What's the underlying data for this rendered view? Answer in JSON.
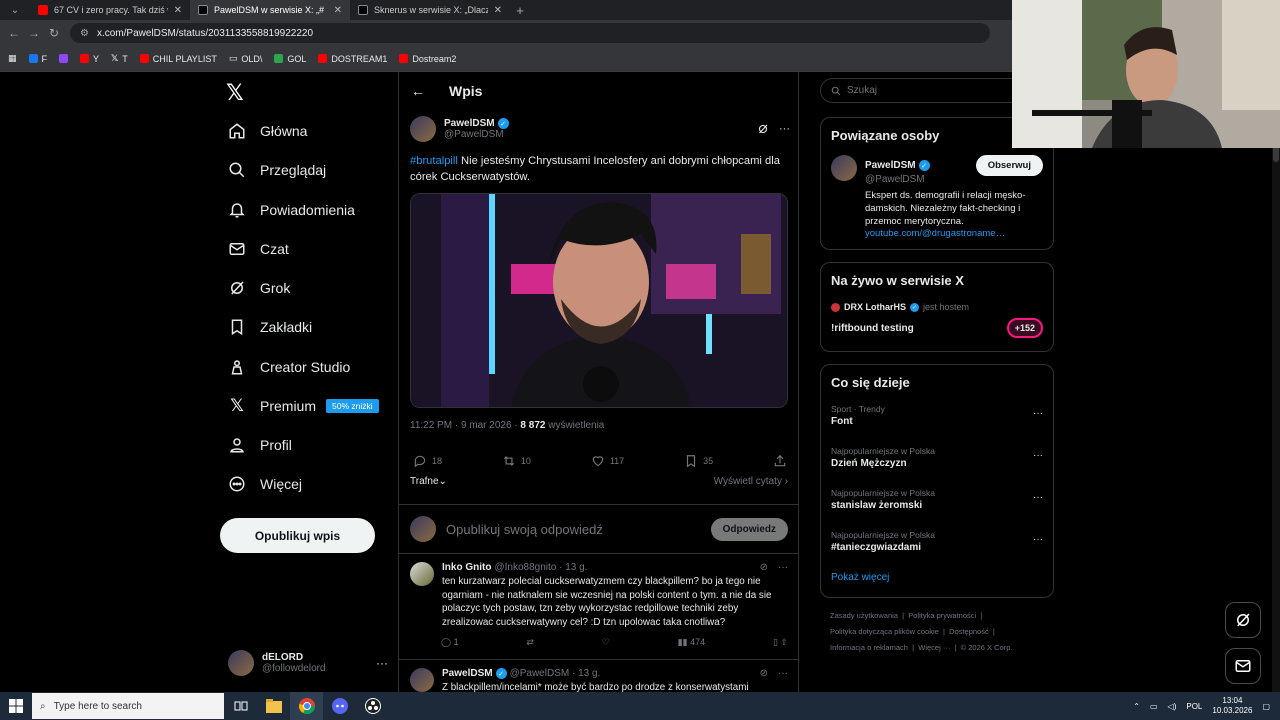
{
  "browser": {
    "tabs": [
      {
        "title": "67 CV i zero pracy. Tak dziś wyg",
        "color": "#ff0000"
      },
      {
        "title": "PawelDSM w serwisie X: „#",
        "color": "#000000",
        "active": true
      },
      {
        "title": "Sknerus w serwisie X: „Dlaczeg",
        "color": "#000000"
      }
    ],
    "url": "x.com/PawelDSM/status/2031133558819922220",
    "bookmarks": [
      {
        "label": "F",
        "color": "#1877f2"
      },
      {
        "label": "",
        "color": "#9146ff"
      },
      {
        "label": "Y",
        "color": "#ff0000"
      },
      {
        "label": "T",
        "color": "#ffffff"
      },
      {
        "label": "CHIL PLAYLIST",
        "color": "#ff0000"
      },
      {
        "label": "OLD\\",
        "color": "#cccccc"
      },
      {
        "label": "GOL",
        "color": "#2ea44f"
      },
      {
        "label": "DOSTREAM1",
        "color": "#ff0000"
      },
      {
        "label": "Dostream2",
        "color": "#ff0000"
      }
    ]
  },
  "sidebar": {
    "items": [
      {
        "label": "Główna",
        "icon": "home-icon"
      },
      {
        "label": "Przeglądaj",
        "icon": "search-icon"
      },
      {
        "label": "Powiadomienia",
        "icon": "bell-icon"
      },
      {
        "label": "Czat",
        "icon": "mail-icon"
      },
      {
        "label": "Grok",
        "icon": "grok-icon"
      },
      {
        "label": "Zakładki",
        "icon": "bookmark-icon"
      },
      {
        "label": "Creator Studio",
        "icon": "creator-icon"
      },
      {
        "label": "Premium",
        "icon": "x-icon"
      },
      {
        "label": "Profil",
        "icon": "person-icon"
      },
      {
        "label": "Więcej",
        "icon": "more-circle-icon"
      }
    ],
    "premium_badge": "50% zniżki",
    "post_button": "Opublikuj wpis",
    "account": {
      "name": "dELORD",
      "handle": "@followdelord"
    }
  },
  "post": {
    "header": "Wpis",
    "author": {
      "name": "PawelDSM",
      "handle": "@PawelDSM"
    },
    "hashtag": "#brutalpill",
    "text": " Nie jesteśmy Chrystusami Incelosfery ani dobrymi chłopcami dla córek Cuckserwatystów.",
    "timestamp": "11:22 PM · 9 mar 2026 · ",
    "views": "8 872",
    "views_label": " wyświetlenia",
    "counts": {
      "replies": "18",
      "reposts": "10",
      "likes": "117",
      "bookmarks": "35"
    },
    "sort_label": "Trafne",
    "quotes_label": "Wyświetl cytaty",
    "reply_placeholder": "Opublikuj swoją odpowiedź",
    "reply_button": "Odpowiedz"
  },
  "comments": [
    {
      "name": "Inko Gnito",
      "handle": "@Inko88gnito · 13 g.",
      "text": "ten kurzatwarz polecial cuckserwatyzmem czy blackpillem? bo ja tego nie ogarniam - nie natknalem sie wczesniej na polski content o tym. a nie da sie polaczyc tych postaw, tzn zeby wykorzystac redpillowe techniki zeby zrealizowac cuckserwatywny cel? :D tzn upolowac taka cnotliwa?",
      "replies": "1",
      "views": "474"
    },
    {
      "name": "PawelDSM",
      "handle": "@PawelDSM · 13 g.",
      "text": "Z blackpillem/incelami* może być bardzo po drodze z konserwatystami"
    }
  ],
  "right": {
    "search_placeholder": "Szukaj",
    "related_title": "Powiązane osoby",
    "related": {
      "name": "PawelDSM",
      "handle": "@PawelDSM",
      "bio": "Ekspert ds. demografii i relacji męsko-damskich. Niezależny fakt-checking i przemoc merytoryczna.",
      "link": "youtube.com/@drugastroname…",
      "follow": "Obserwuj"
    },
    "live_title": "Na żywo w serwisie X",
    "live": {
      "host": "DRX LotharHS",
      "host_label": "jest hostem",
      "title": "!riftbound testing",
      "count": "+152"
    },
    "trends_title": "Co się dzieje",
    "trends": [
      {
        "context": "Sport · Trendy",
        "name": "Font"
      },
      {
        "context": "Najpopularniejsze w Polska",
        "name": "Dzień Mężczyzn"
      },
      {
        "context": "Najpopularniejsze w Polska",
        "name": "stanislaw żeromski"
      },
      {
        "context": "Najpopularniejsze w Polska",
        "name": "#tanieczgwiazdami"
      }
    ],
    "show_more": "Pokaż więcej",
    "footer": [
      "Zasady użytkowania",
      "Polityka prywatności",
      "Polityka dotycząca plików cookie",
      "Dostępność",
      "Informacja o reklamach",
      "Więcej ···",
      "© 2026 X Corp."
    ]
  },
  "taskbar": {
    "search_placeholder": "Type here to search",
    "lang": "POL",
    "time": "13:04",
    "date": "10.03.2026"
  },
  "colors": {
    "accent": "#1d9bf0",
    "bg": "#000000",
    "border": "#2f3336",
    "muted": "#71767b"
  }
}
